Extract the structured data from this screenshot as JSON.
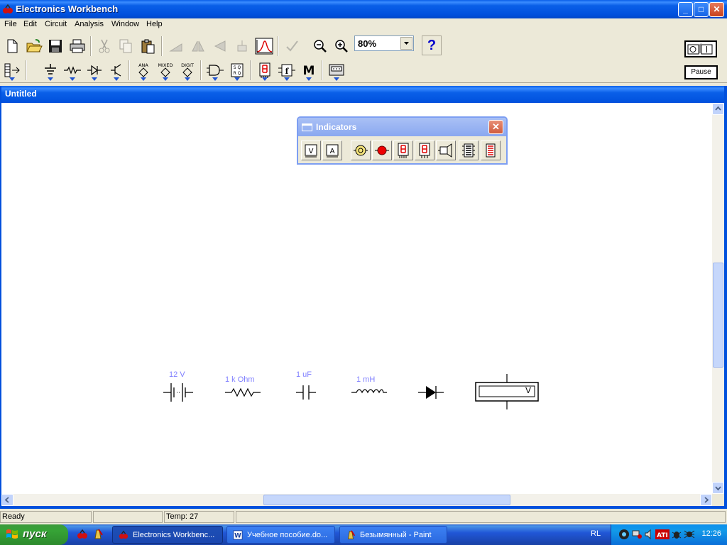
{
  "app": {
    "title": "Electronics Workbench",
    "caption_buttons": {
      "minimize": "_",
      "maximize": "□",
      "close": "✕"
    }
  },
  "menu": [
    "File",
    "Edit",
    "Circuit",
    "Analysis",
    "Window",
    "Help"
  ],
  "toolbar": {
    "zoom_value": "80%",
    "help_label": "?",
    "pause_label": "Pause",
    "power_label": "O I"
  },
  "document": {
    "title": "Untitled"
  },
  "palette": {
    "title": "Indicators",
    "close": "✕",
    "items": [
      {
        "name": "voltmeter",
        "glyph": "V"
      },
      {
        "name": "ammeter",
        "glyph": "A"
      }
    ]
  },
  "components": [
    {
      "name": "battery",
      "label": "12 V"
    },
    {
      "name": "resistor",
      "label": "1 k Ohm"
    },
    {
      "name": "capacitor",
      "label": "1 uF"
    },
    {
      "name": "inductor",
      "label": "1 mH"
    },
    {
      "name": "diode",
      "label": ""
    },
    {
      "name": "voltmeter",
      "label": "V"
    }
  ],
  "status": {
    "ready": "Ready",
    "temp": "Temp:  27"
  },
  "taskbar": {
    "start": "пуск",
    "tasks": [
      "Electronics Workbenc...",
      "Учебное пособие.do...",
      "Безымянный - Paint"
    ],
    "lang": "RL",
    "clock": "12:26"
  }
}
